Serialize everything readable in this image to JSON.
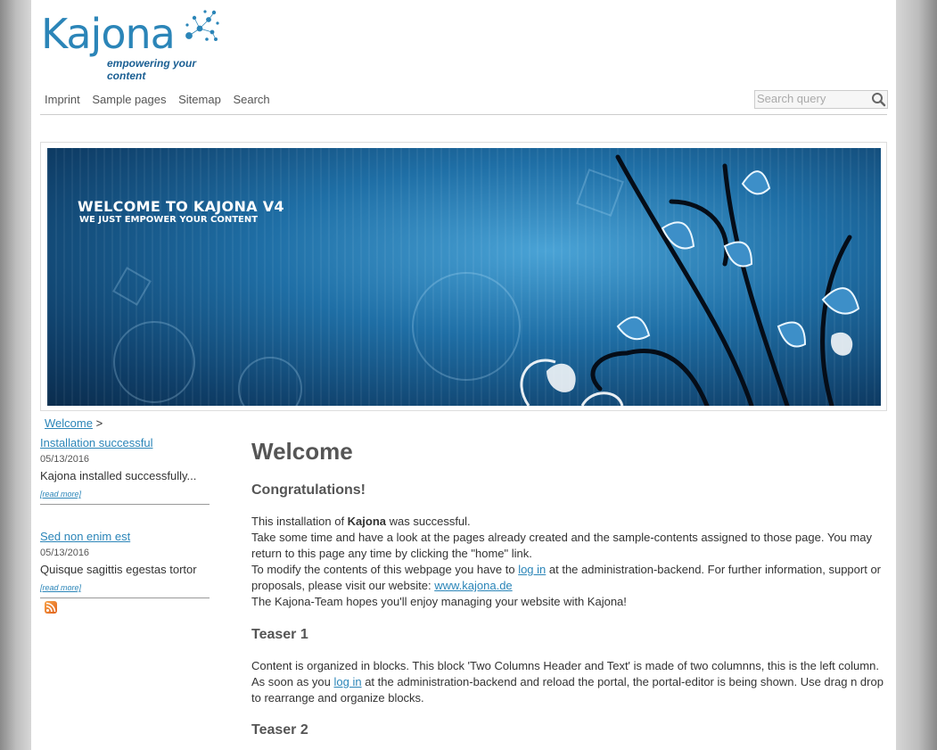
{
  "logo": {
    "word": "Kajona",
    "tagline": "empowering your content"
  },
  "nav": {
    "items": [
      "Imprint",
      "Sample pages",
      "Sitemap",
      "Search"
    ]
  },
  "search": {
    "placeholder": "Search query"
  },
  "banner": {
    "title": "WELCOME TO KAJONA V4",
    "subtitle": "WE JUST EMPOWER YOUR CONTENT"
  },
  "breadcrumb": {
    "link": "Welcome",
    "separator": ">"
  },
  "sidebar": {
    "news": [
      {
        "title": "Installation successful",
        "date": "05/13/2016",
        "teaser": "Kajona installed successfully...",
        "more": "[read more]"
      },
      {
        "title": "Sed non enim est",
        "date": "05/13/2016",
        "teaser": "Quisque sagittis egestas tortor",
        "more": "[read more]"
      }
    ]
  },
  "main": {
    "heading": "Welcome",
    "subheading": "Congratulations!",
    "intro": {
      "p1_pre": "This installation of ",
      "p1_bold": "Kajona",
      "p1_post": " was successful.",
      "p2": "Take some time and have a look at the pages already created and the sample-contents assigned to those page. You may return to this page any time by clicking the \"home\" link.",
      "p3_pre": "To modify the contents of this webpage you have to ",
      "p3_link": "log in",
      "p3_mid": " at the administration-backend. For further information, support or proposals, please visit our website: ",
      "p3_link2": "www.kajona.de",
      "p4": "The Kajona-Team hopes you'll enjoy managing your website with Kajona!"
    },
    "teaser1": {
      "title": "Teaser 1",
      "pre": "Content is organized in blocks. This block 'Two Columns Header and Text' is made of two columnns, this is the left column. As soon as you ",
      "link": "log in",
      "post": " at the administration-backend and reload the portal, the portal-editor is being shown. Use drag n drop to rearrange and organize blocks."
    },
    "teaser2": {
      "title": "Teaser 2"
    }
  },
  "colors": {
    "brand": "#2b85b8",
    "link": "#2b85b8",
    "heading": "#555555"
  }
}
